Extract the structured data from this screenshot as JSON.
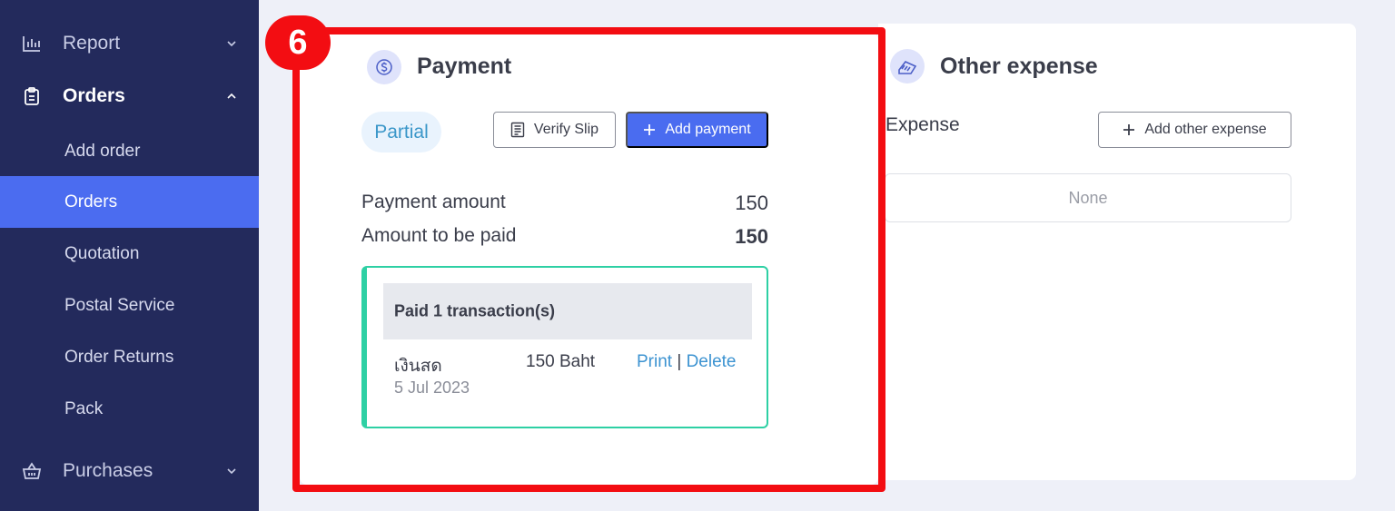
{
  "sidebar": {
    "groups": [
      {
        "label": "Report",
        "icon": "bar-chart-icon",
        "expanded": false
      },
      {
        "label": "Orders",
        "icon": "clipboard-icon",
        "expanded": true
      },
      {
        "label": "Purchases",
        "icon": "basket-icon",
        "expanded": false
      }
    ],
    "sub_items": [
      "Add order",
      "Orders",
      "Quotation",
      "Postal Service",
      "Order Returns",
      "Pack"
    ],
    "active_sub_item": "Orders"
  },
  "callout": {
    "step": "6"
  },
  "payment": {
    "title": "Payment",
    "status": "Partial",
    "verify_slip_label": "Verify Slip",
    "add_payment_label": "Add payment",
    "payment_amount_label": "Payment amount",
    "payment_amount_value": "150",
    "amount_to_be_paid_label": "Amount to be paid",
    "amount_to_be_paid_value": "150",
    "transactions_header": "Paid 1 transaction(s)",
    "transaction": {
      "method": "เงินสด",
      "amount": "150 Baht",
      "date": "5 Jul 2023",
      "print_label": "Print",
      "separator": "|",
      "delete_label": "Delete"
    }
  },
  "other_expense": {
    "title": "Other expense",
    "expense_label": "Expense",
    "add_label": "Add other expense",
    "empty_text": "None"
  },
  "colors": {
    "sidebar_bg": "#232a5c",
    "active_item": "#4b6cf0",
    "highlight": "#f30d12",
    "transaction_border": "#2ed0a4",
    "link": "#3c93d1"
  }
}
